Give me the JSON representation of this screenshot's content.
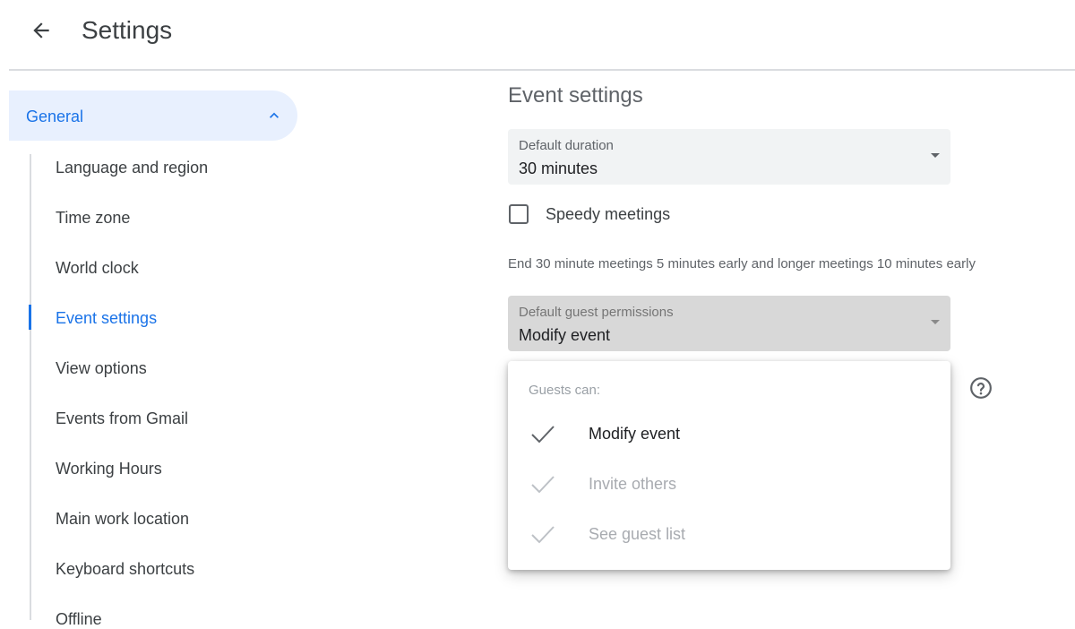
{
  "header": {
    "title": "Settings",
    "back_icon": "arrow-back-icon"
  },
  "sidebar": {
    "section": {
      "label": "General",
      "icon": "chevron-up-icon",
      "expanded": true
    },
    "items": [
      {
        "label": "Language and region",
        "active": false
      },
      {
        "label": "Time zone",
        "active": false
      },
      {
        "label": "World clock",
        "active": false
      },
      {
        "label": "Event settings",
        "active": true
      },
      {
        "label": "View options",
        "active": false
      },
      {
        "label": "Events from Gmail",
        "active": false
      },
      {
        "label": "Working Hours",
        "active": false
      },
      {
        "label": "Main work location",
        "active": false
      },
      {
        "label": "Keyboard shortcuts",
        "active": false
      },
      {
        "label": "Offline",
        "active": false
      }
    ]
  },
  "main": {
    "section_title": "Event settings",
    "default_duration": {
      "label": "Default duration",
      "value": "30 minutes"
    },
    "speedy_meetings": {
      "label": "Speedy meetings",
      "checked": false
    },
    "speedy_hint": "End 30 minute meetings 5 minutes early and longer meetings 10 minutes early",
    "guest_permissions": {
      "label": "Default guest permissions",
      "value": "Modify event"
    },
    "help_icon": "help-circle-icon",
    "dropdown": {
      "header": "Guests can:",
      "options": [
        {
          "label": "Modify event",
          "enabled": true,
          "checked": true
        },
        {
          "label": "Invite others",
          "enabled": false,
          "checked": true
        },
        {
          "label": "See guest list",
          "enabled": false,
          "checked": true
        }
      ]
    }
  },
  "colors": {
    "accent": "#1a73e8",
    "text_primary": "#3c4043",
    "text_secondary": "#5f6368",
    "active_pill": "#e8f0fe",
    "select_bg": "#f1f3f4",
    "select_disabled_bg": "#d8d8d8",
    "divider": "#dadce0"
  }
}
